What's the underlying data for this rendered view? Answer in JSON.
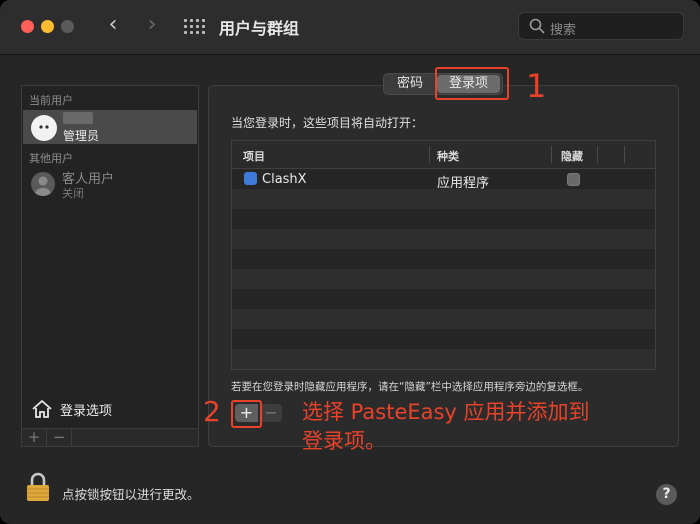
{
  "window": {
    "title": "用户与群组",
    "search_placeholder": "搜索"
  },
  "sidebar": {
    "current_users_label": "当前用户",
    "current_user_role": "管理员",
    "other_users_label": "其他用户",
    "guest_name": "客人用户",
    "guest_status": "关闭",
    "login_options_label": "登录选项",
    "add_label": "+",
    "remove_label": "−"
  },
  "tabs": {
    "password": "密码",
    "login_items": "登录项"
  },
  "main": {
    "description": "当您登录时，这些项目将自动打开：",
    "columns": [
      "项目",
      "种类",
      "隐藏"
    ],
    "rows": [
      {
        "item": "ClashX",
        "kind": "应用程序",
        "hidden": false
      }
    ],
    "hint": "若要在您登录时隐藏应用程序，请在“隐藏”栏中选择应用程序旁边的复选框。",
    "add_label": "+",
    "remove_label": "−"
  },
  "annotations": {
    "marker_1": "1",
    "marker_2": "2",
    "text_line1": "选择 PasteEasy 应用并添加到",
    "text_line2": "登录项。",
    "color": "#e8432a"
  },
  "footer": {
    "lock_label": "点按锁按钮以进行更改。",
    "help_label": "?"
  }
}
